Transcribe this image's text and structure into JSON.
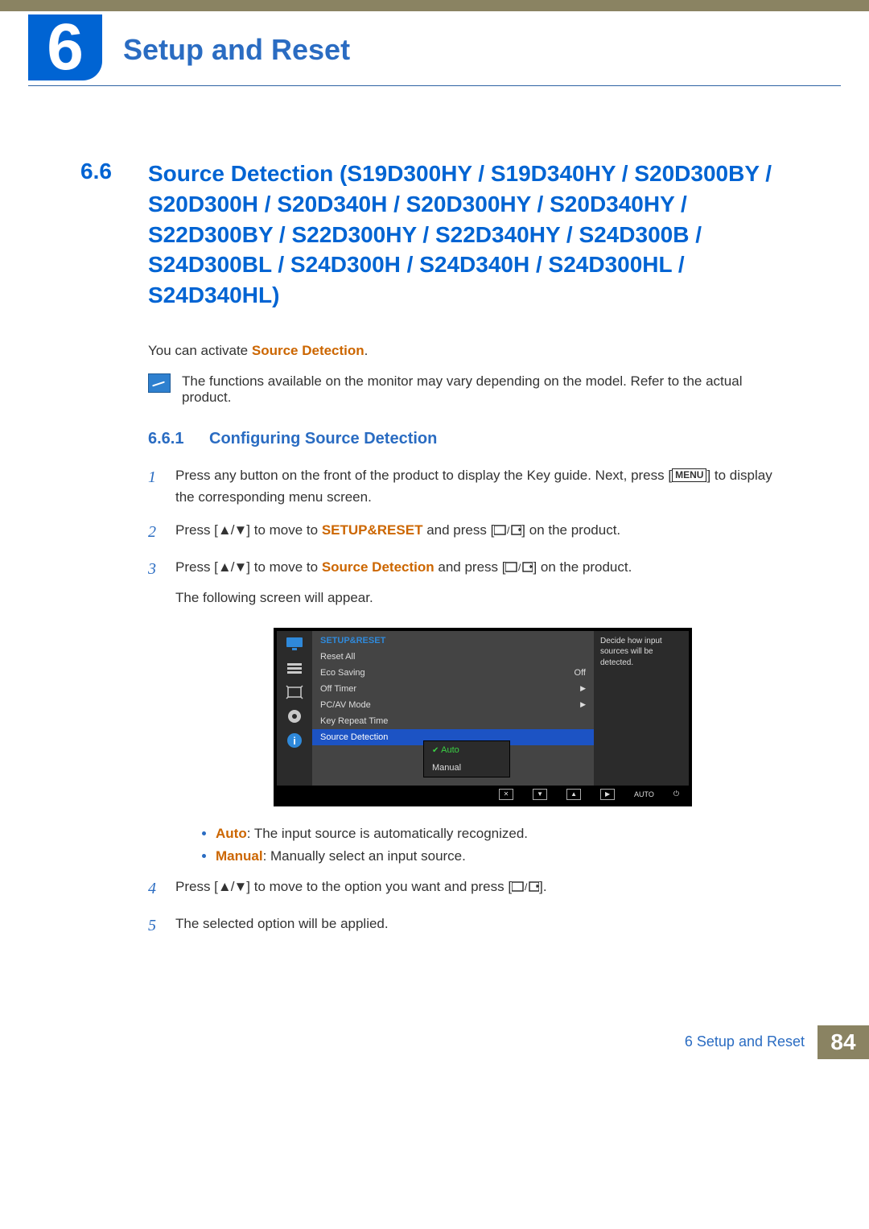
{
  "chapter": {
    "number": "6",
    "title": "Setup and Reset"
  },
  "section": {
    "number": "6.6",
    "title": "Source Detection (S19D300HY / S19D340HY / S20D300BY / S20D300H / S20D340H / S20D300HY / S20D340HY / S22D300BY / S22D300HY / S22D340HY / S24D300B / S24D300BL / S24D300H / S24D340H / S24D300HL / S24D340HL)"
  },
  "intro": {
    "prefix": "You can activate ",
    "term": "Source Detection",
    "suffix": "."
  },
  "note": "The functions available on the monitor may vary depending on the model. Refer to the actual product.",
  "subsection": {
    "number": "6.6.1",
    "title": "Configuring Source Detection"
  },
  "steps": {
    "s1a": "Press any button on the front of the product to display the Key guide. Next, press [",
    "s1b": "] to display the corresponding menu screen.",
    "menu_key": "MENU",
    "s2a": "Press [",
    "s2mid": "] to move to ",
    "s2term": "SETUP&RESET",
    "s2b": " and press [",
    "s2c": "] on the product.",
    "s3a": "Press [",
    "s3mid": "] to move to ",
    "s3term": "Source Detection",
    "s3b": " and press [",
    "s3c": "] on the product.",
    "s3_follow": "The following screen will appear.",
    "s4a": "Press [",
    "s4mid": "] to move to the option you want and press [",
    "s4b": "].",
    "s5": "The selected option will be applied."
  },
  "osd": {
    "title": "SETUP&RESET",
    "rows": [
      {
        "label": "Reset All",
        "value": ""
      },
      {
        "label": "Eco Saving",
        "value": "Off"
      },
      {
        "label": "Off Timer",
        "value": "▶"
      },
      {
        "label": "PC/AV Mode",
        "value": "▶"
      },
      {
        "label": "Key Repeat Time",
        "value": ""
      },
      {
        "label": "Source Detection",
        "value": "",
        "selected": true
      }
    ],
    "popup": {
      "auto": "Auto",
      "manual": "Manual"
    },
    "info": "Decide how input sources will be detected.",
    "bottom_auto": "AUTO"
  },
  "bullets": {
    "auto_term": "Auto",
    "auto_text": ": The input source is automatically recognized.",
    "manual_term": "Manual",
    "manual_text": ": Manually select an input source."
  },
  "footer": {
    "text": "6 Setup and Reset",
    "page": "84"
  }
}
